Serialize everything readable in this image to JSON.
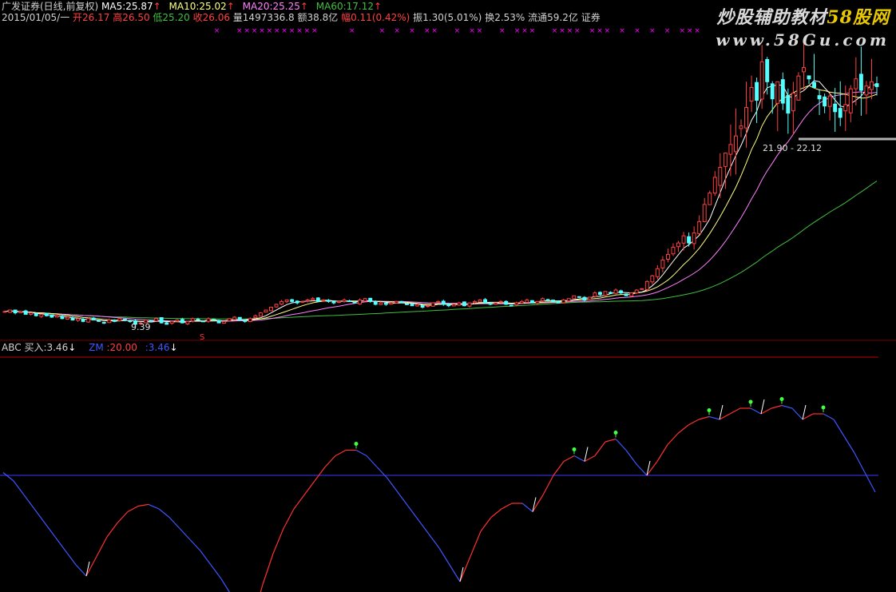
{
  "header": {
    "name": "广发证券(日线,前复权)",
    "ma5_label": "MA5:",
    "ma5_value": "25.87",
    "ma10_label": "MA10:",
    "ma10_value": "25.02",
    "ma20_label": "MA20:",
    "ma20_value": "25.25",
    "ma60_label": "MA60:",
    "ma60_value": "17.12",
    "up_arrow": "↑",
    "date": "2015/01/05/一",
    "open": "开26.17",
    "high": "高26.50",
    "low": "低25.20",
    "close": "收26.06",
    "volume": "量1497336.8",
    "amount": "额38.8亿",
    "change": "幅0.11(0.42%)",
    "amplitude": "振1.30(5.01%)",
    "turnover": "换2.53%",
    "float": "流通59.2亿",
    "sector": "证券"
  },
  "indicator": {
    "name": "ABC",
    "buy_label": "买入:",
    "buy_value": "3.46",
    "down_arrow": "↓",
    "line_label": "ZM",
    "level_label": ":20.00",
    "second_value": ":3.46"
  },
  "watermark": {
    "line1_prefix": "炒股辅助教材",
    "line1_accent": "58股网",
    "line2": "www.58Gu.com"
  },
  "colors": {
    "up": "#ff4040",
    "down": "#54ffff",
    "ma5": "#ffffff",
    "ma10": "#ffff80",
    "ma20": "#ff80ff",
    "ma60": "#40c040",
    "ind_rise": "#ff3030",
    "ind_fall": "#3d56ff",
    "level_line": "#3a3aff",
    "separator": "#c00000",
    "marker": "#40ff40",
    "x_marker": "#ff00ff"
  },
  "chart_data": [
    {
      "type": "candlestick",
      "title": "广发证券(日线,前复权)",
      "annotations": [
        "9.39",
        "21.90 - 22.12"
      ],
      "ylim": [
        8.5,
        30
      ],
      "close": [
        10.3,
        10.4,
        10.2,
        10.3,
        10.1,
        10.2,
        10.0,
        10.1,
        10.0,
        9.9,
        10.0,
        9.8,
        9.9,
        9.7,
        9.8,
        9.6,
        9.8,
        9.7,
        9.6,
        9.5,
        9.7,
        9.6,
        9.8,
        9.7,
        9.6,
        9.4,
        9.5,
        9.7,
        9.6,
        9.8,
        9.5,
        9.4,
        9.6,
        9.7,
        9.5,
        9.6,
        9.8,
        9.7,
        9.6,
        9.8,
        9.7,
        9.5,
        9.6,
        9.8,
        9.9,
        9.7,
        9.6,
        9.8,
        10.0,
        10.2,
        10.4,
        10.6,
        10.8,
        11.0,
        11.1,
        11.0,
        10.9,
        11.0,
        11.1,
        11.2,
        11.0,
        11.1,
        11.0,
        10.9,
        11.0,
        11.1,
        11.0,
        10.9,
        11.1,
        11.2,
        11.0,
        10.8,
        10.9,
        10.8,
        10.9,
        11.0,
        10.9,
        10.8,
        10.7,
        10.8,
        10.6,
        10.7,
        10.9,
        11.0,
        10.8,
        10.7,
        10.8,
        10.9,
        10.7,
        10.9,
        11.0,
        11.1,
        10.9,
        10.8,
        10.9,
        11.0,
        10.8,
        10.7,
        10.9,
        11.0,
        11.1,
        10.9,
        11.0,
        11.2,
        11.1,
        11.0,
        10.9,
        11.1,
        11.2,
        11.4,
        11.3,
        11.1,
        11.3,
        11.6,
        11.5,
        11.7,
        11.6,
        11.8,
        11.6,
        11.4,
        11.6,
        11.8,
        11.9,
        12.4,
        12.8,
        13.3,
        13.9,
        14.3,
        14.8,
        15.1,
        15.6,
        15.1,
        15.8,
        16.6,
        17.8,
        18.6,
        19.7,
        20.4,
        21.4,
        22.0,
        22.6,
        23.3,
        24.6,
        26.0,
        25.1,
        27.8,
        26.4,
        25.2,
        26.4,
        24.9,
        24.2,
        25.6,
        26.8,
        27.4,
        26.6,
        26.0,
        25.2,
        24.7,
        25.4,
        24.3,
        23.9,
        24.8,
        25.9,
        26.6,
        25.8,
        26.1,
        26.4,
        26.06
      ]
    },
    {
      "type": "line",
      "title": "ABC",
      "ylim": [
        0,
        40
      ],
      "level": 20.0,
      "values": [
        20.5,
        19.0,
        16.5,
        14.0,
        11.5,
        9.0,
        6.5,
        4.0,
        2.0,
        5.5,
        9.0,
        11.5,
        13.5,
        14.5,
        14.8,
        14.0,
        12.5,
        10.5,
        8.5,
        6.5,
        4.0,
        1.5,
        -1.5,
        -4.0,
        -6.0,
        0.5,
        6.0,
        10.5,
        14.0,
        16.5,
        19.0,
        21.5,
        23.5,
        24.5,
        24.5,
        23.5,
        21.5,
        19.5,
        17.0,
        14.5,
        12.0,
        9.5,
        7.0,
        4.0,
        1.0,
        5.5,
        10.0,
        12.5,
        14.0,
        15.0,
        15.0,
        13.5,
        16.5,
        20.0,
        22.5,
        23.5,
        22.5,
        23.5,
        26.0,
        26.5,
        24.5,
        22.0,
        20.0,
        22.5,
        25.5,
        27.5,
        29.0,
        30.0,
        30.5,
        30.0,
        31.0,
        32.0,
        32.0,
        31.0,
        32.0,
        32.5,
        32.0,
        30.0,
        31.0,
        31.0,
        30.0,
        27.0,
        24.0,
        20.5,
        17.0
      ]
    }
  ]
}
